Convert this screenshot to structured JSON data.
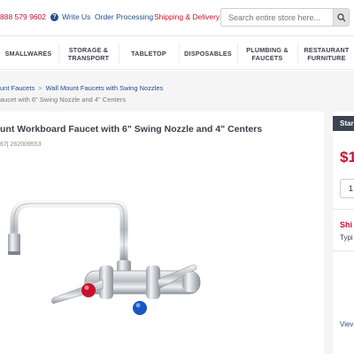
{
  "header": {
    "phone": "888 579 9602",
    "write_us": "Write Us",
    "order_processing": "Order Processing",
    "shipping_delivery": "Shipping & Delivery",
    "search_placeholder": "Search entire store here..."
  },
  "nav": {
    "items": [
      {
        "label": "SMALLWARES"
      },
      {
        "label": "STORAGE & TRANSPORT"
      },
      {
        "label": "TABLETOP"
      },
      {
        "label": "DISPOSABLES"
      },
      {
        "label": "PLUMBING & FAUCETS"
      },
      {
        "label": "RESTAURANT FURNITURE"
      }
    ]
  },
  "breadcrumb": {
    "item1": "unt Faucets",
    "separator": ">",
    "item2": "Wall Mount Faucets with Swing Nozzles",
    "current": "aucet with 6\" Swing Nozzle and 4\" Centers"
  },
  "product": {
    "title": "unt Workboard Faucet with 6\" Swing Nozzle and 4\" Centers",
    "sku": "67| 262009553"
  },
  "purchase": {
    "header": "Star",
    "price": "$1",
    "quantity": "1",
    "shipping_heading": "Shi",
    "shipping_text": "Typi",
    "view_link": "Viev"
  },
  "colors": {
    "brand_red": "#c8102e",
    "link_blue": "#1f4e8c",
    "panel_dark": "#3a4453",
    "hot_handle": "#c8102e",
    "cold_handle": "#1a56c4"
  }
}
